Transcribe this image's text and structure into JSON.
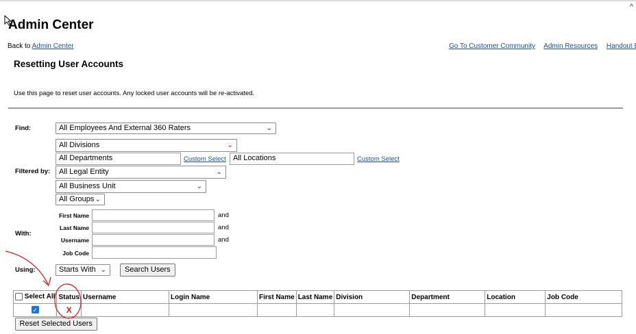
{
  "header": {
    "title": "Admin Center",
    "back_prefix": "Back to",
    "back_link": "Admin Center",
    "links": [
      "Go To Customer Community",
      "Admin Resources",
      "Handout Bu"
    ]
  },
  "page": {
    "section_title": "Resetting User Accounts",
    "description": "Use this page to reset user accounts. Any locked user accounts will be re-activated."
  },
  "filters": {
    "find_label": "Find:",
    "find_value": "All Employees And External 360 Raters",
    "filtered_by_label": "Filtered by:",
    "divisions": "All Divisions",
    "departments": "All Departments",
    "custom_select": "Custom Select",
    "locations": "All Locations",
    "legal_entity": "All Legal Entity",
    "business_unit": "All Business Unit",
    "groups": "All Groups"
  },
  "with": {
    "label": "With:",
    "first_name": "First Name",
    "last_name": "Last Name",
    "username": "Username",
    "job_code": "Job Code",
    "and": "and"
  },
  "using": {
    "label": "Using:",
    "value": "Starts With",
    "search_button": "Search Users"
  },
  "results": {
    "select_all": "Select All",
    "columns": [
      "Status",
      "Username",
      "Login Name",
      "First Name",
      "Last Name",
      "Division",
      "Department",
      "Location",
      "Job Code"
    ],
    "row": {
      "status": "X",
      "selected": true
    },
    "reset_button": "Reset Selected Users"
  },
  "colors": {
    "link": "#1a4f9b",
    "status_x": "#d02020",
    "annotation": "#d81e1e",
    "checkbox": "#1a73e8"
  }
}
